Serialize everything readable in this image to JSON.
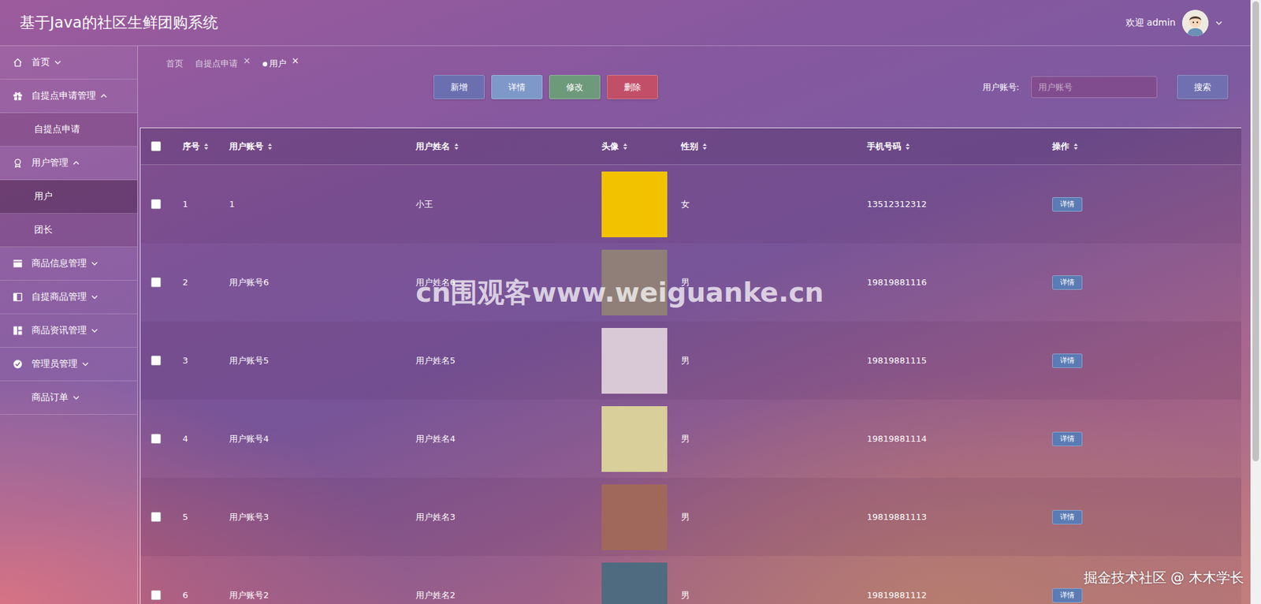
{
  "header": {
    "title": "基于Java的社区生鲜团购系统",
    "welcome": "欢迎 admin"
  },
  "sidebar": {
    "items": [
      {
        "label": "首页",
        "kind": "group",
        "expanded": false
      },
      {
        "label": "自提点申请管理",
        "kind": "group",
        "expanded": true
      },
      {
        "label": "自提点申请",
        "kind": "sub",
        "selected": false
      },
      {
        "label": "用户管理",
        "kind": "group",
        "expanded": true
      },
      {
        "label": "用户",
        "kind": "sub",
        "selected": true
      },
      {
        "label": "团长",
        "kind": "sub",
        "selected": false
      },
      {
        "label": "商品信息管理",
        "kind": "group",
        "expanded": false
      },
      {
        "label": "自提商品管理",
        "kind": "group",
        "expanded": false
      },
      {
        "label": "商品资讯管理",
        "kind": "group",
        "expanded": false
      },
      {
        "label": "管理员管理",
        "kind": "group",
        "expanded": false
      },
      {
        "label": "商品订单",
        "kind": "group",
        "expanded": false
      }
    ]
  },
  "tabs": [
    {
      "label": "首页",
      "selected": false
    },
    {
      "label": "自提点申请",
      "close": "×",
      "selected": false
    },
    {
      "label": "用户",
      "close": "×",
      "selected": true
    }
  ],
  "toolbar": {
    "buttons": [
      {
        "label": "新增",
        "color": "#6b6fb0"
      },
      {
        "label": "详情",
        "color": "#7e98c9"
      },
      {
        "label": "修改",
        "color": "#6e9a7c"
      },
      {
        "label": "删除",
        "color": "#c24f68"
      }
    ]
  },
  "search": {
    "label": "用户账号:",
    "placeholder": "用户账号",
    "button": "搜索"
  },
  "table": {
    "all_checked": false,
    "columns": [
      {
        "label": "序号",
        "sortable": true
      },
      {
        "label": "用户账号",
        "sortable": true
      },
      {
        "label": "用户姓名",
        "sortable": true
      },
      {
        "label": "头像",
        "sortable": true
      },
      {
        "label": "性别",
        "sortable": true
      },
      {
        "label": "手机号码",
        "sortable": true
      },
      {
        "label": "操作",
        "sortable": true
      }
    ],
    "rows": [
      {
        "checked": false,
        "index": "1",
        "account": "1",
        "name": "小王",
        "gender": "女",
        "phone": "13512312312",
        "action": "详情"
      },
      {
        "checked": false,
        "index": "2",
        "account": "用户账号6",
        "name": "用户姓名6",
        "gender": "男",
        "phone": "19819881116",
        "action": "详情"
      },
      {
        "checked": false,
        "index": "3",
        "account": "用户账号5",
        "name": "用户姓名5",
        "gender": "男",
        "phone": "19819881115",
        "action": "详情"
      },
      {
        "checked": false,
        "index": "4",
        "account": "用户账号4",
        "name": "用户姓名4",
        "gender": "男",
        "phone": "19819881114",
        "action": "详情"
      },
      {
        "checked": false,
        "index": "5",
        "account": "用户账号3",
        "name": "用户姓名3",
        "gender": "男",
        "phone": "19819881113",
        "action": "详情"
      },
      {
        "checked": false,
        "index": "6",
        "account": "用户账号2",
        "name": "用户姓名2",
        "gender": "男",
        "phone": "19819881112",
        "action": "详情"
      }
    ]
  },
  "watermarks": [
    "cn围观客www.weiguanke.cn",
    "掘金技术社区 @ 木木学长"
  ]
}
